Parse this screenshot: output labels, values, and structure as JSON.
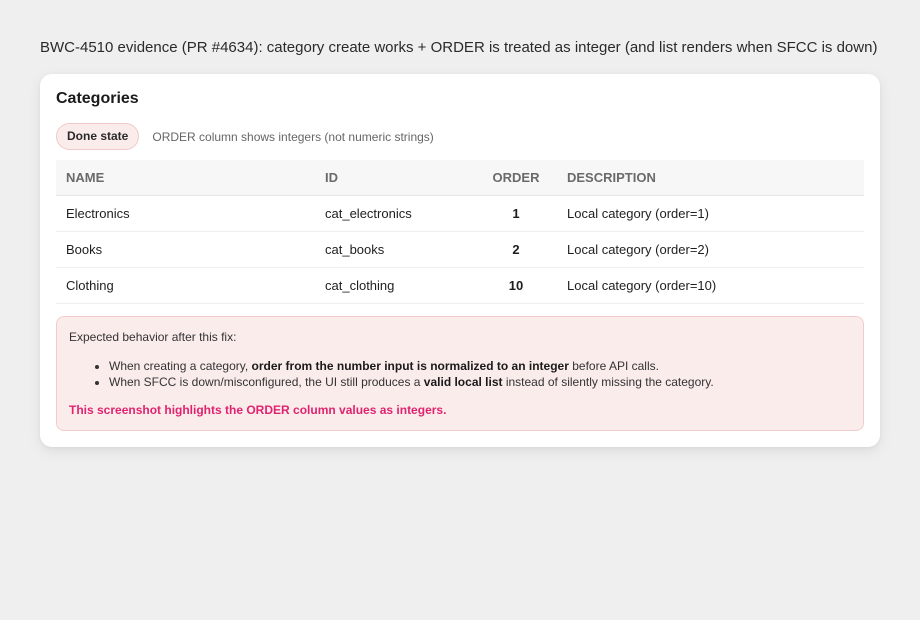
{
  "page": {
    "heading": "BWC-4510 evidence (PR #4634): category create works + ORDER is treated as integer (and list renders when SFCC is down)"
  },
  "card": {
    "title": "Categories",
    "badge": "Done state",
    "status_note": "ORDER column shows integers (not numeric strings)"
  },
  "table": {
    "columns": [
      "NAME",
      "ID",
      "ORDER",
      "DESCRIPTION"
    ],
    "rows": [
      {
        "name": "Electronics",
        "id": "cat_electronics",
        "order": "1",
        "description": "Local category (order=1)"
      },
      {
        "name": "Books",
        "id": "cat_books",
        "order": "2",
        "description": "Local category (order=2)"
      },
      {
        "name": "Clothing",
        "id": "cat_clothing",
        "order": "10",
        "description": "Local category (order=10)"
      }
    ]
  },
  "notice": {
    "title": "Expected behavior after this fix:",
    "items": [
      {
        "pre": "When creating a category, ",
        "bold": "order from the number input is normalized to an integer",
        "post": " before API calls."
      },
      {
        "pre": "When SFCC is down/misconfigured, the UI still produces a ",
        "bold": "valid local list",
        "post": " instead of silently missing the category."
      }
    ],
    "highlight": "This screenshot highlights the ORDER column values as integers."
  },
  "colors": {
    "background": "#efefef",
    "card": "#ffffff",
    "badge_bg": "#fbecec",
    "notice_bg": "#fbecec",
    "highlight": "#e0236f"
  }
}
